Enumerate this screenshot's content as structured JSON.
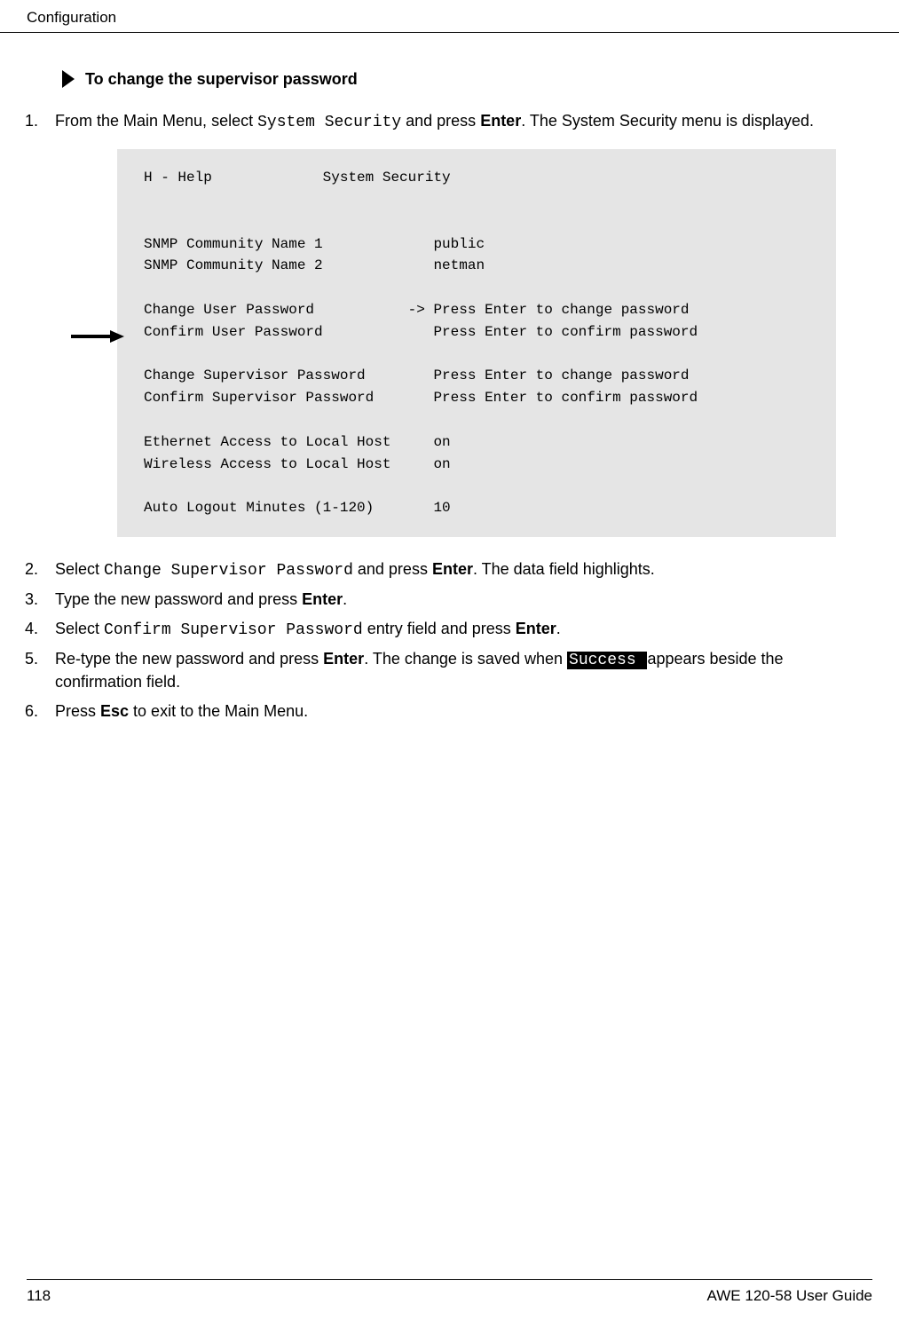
{
  "header": {
    "section": "Configuration"
  },
  "heading": {
    "title": "To change the supervisor password"
  },
  "steps": {
    "s1_pre": "From the Main Menu, select ",
    "s1_mono": "System Security",
    "s1_mid": " and press ",
    "s1_enter": "Enter",
    "s1_post": ". The System Security menu is displayed.",
    "s2_pre": "Select ",
    "s2_mono": "Change Supervisor Password",
    "s2_mid": " and press ",
    "s2_enter": "Enter",
    "s2_post": ". The data field highlights.",
    "s3_pre": "Type the new password and press ",
    "s3_enter": "Enter",
    "s3_post": ".",
    "s4_pre": "Select ",
    "s4_mono": "Confirm Supervisor Password",
    "s4_mid": " entry field and press ",
    "s4_enter": "Enter",
    "s4_post": ".",
    "s5_pre": "Re-type the new password and press ",
    "s5_enter": "Enter",
    "s5_mid": ". The change is saved when ",
    "s5_success": "Success ",
    "s5_post": " appears beside the confirmation field.",
    "s6_pre": "Press ",
    "s6_esc": "Esc",
    "s6_post": " to exit to the Main Menu."
  },
  "screen": {
    "text": "H - Help             System Security\n\n\nSNMP Community Name 1             public\nSNMP Community Name 2             netman\n\nChange User Password           -> Press Enter to change password\nConfirm User Password             Press Enter to confirm password\n\nChange Supervisor Password        Press Enter to change password\nConfirm Supervisor Password       Press Enter to confirm password\n\nEthernet Access to Local Host     on\nWireless Access to Local Host     on\n\nAuto Logout Minutes (1-120)       10"
  },
  "footer": {
    "page": "118",
    "guide": "AWE 120-58 User Guide"
  }
}
